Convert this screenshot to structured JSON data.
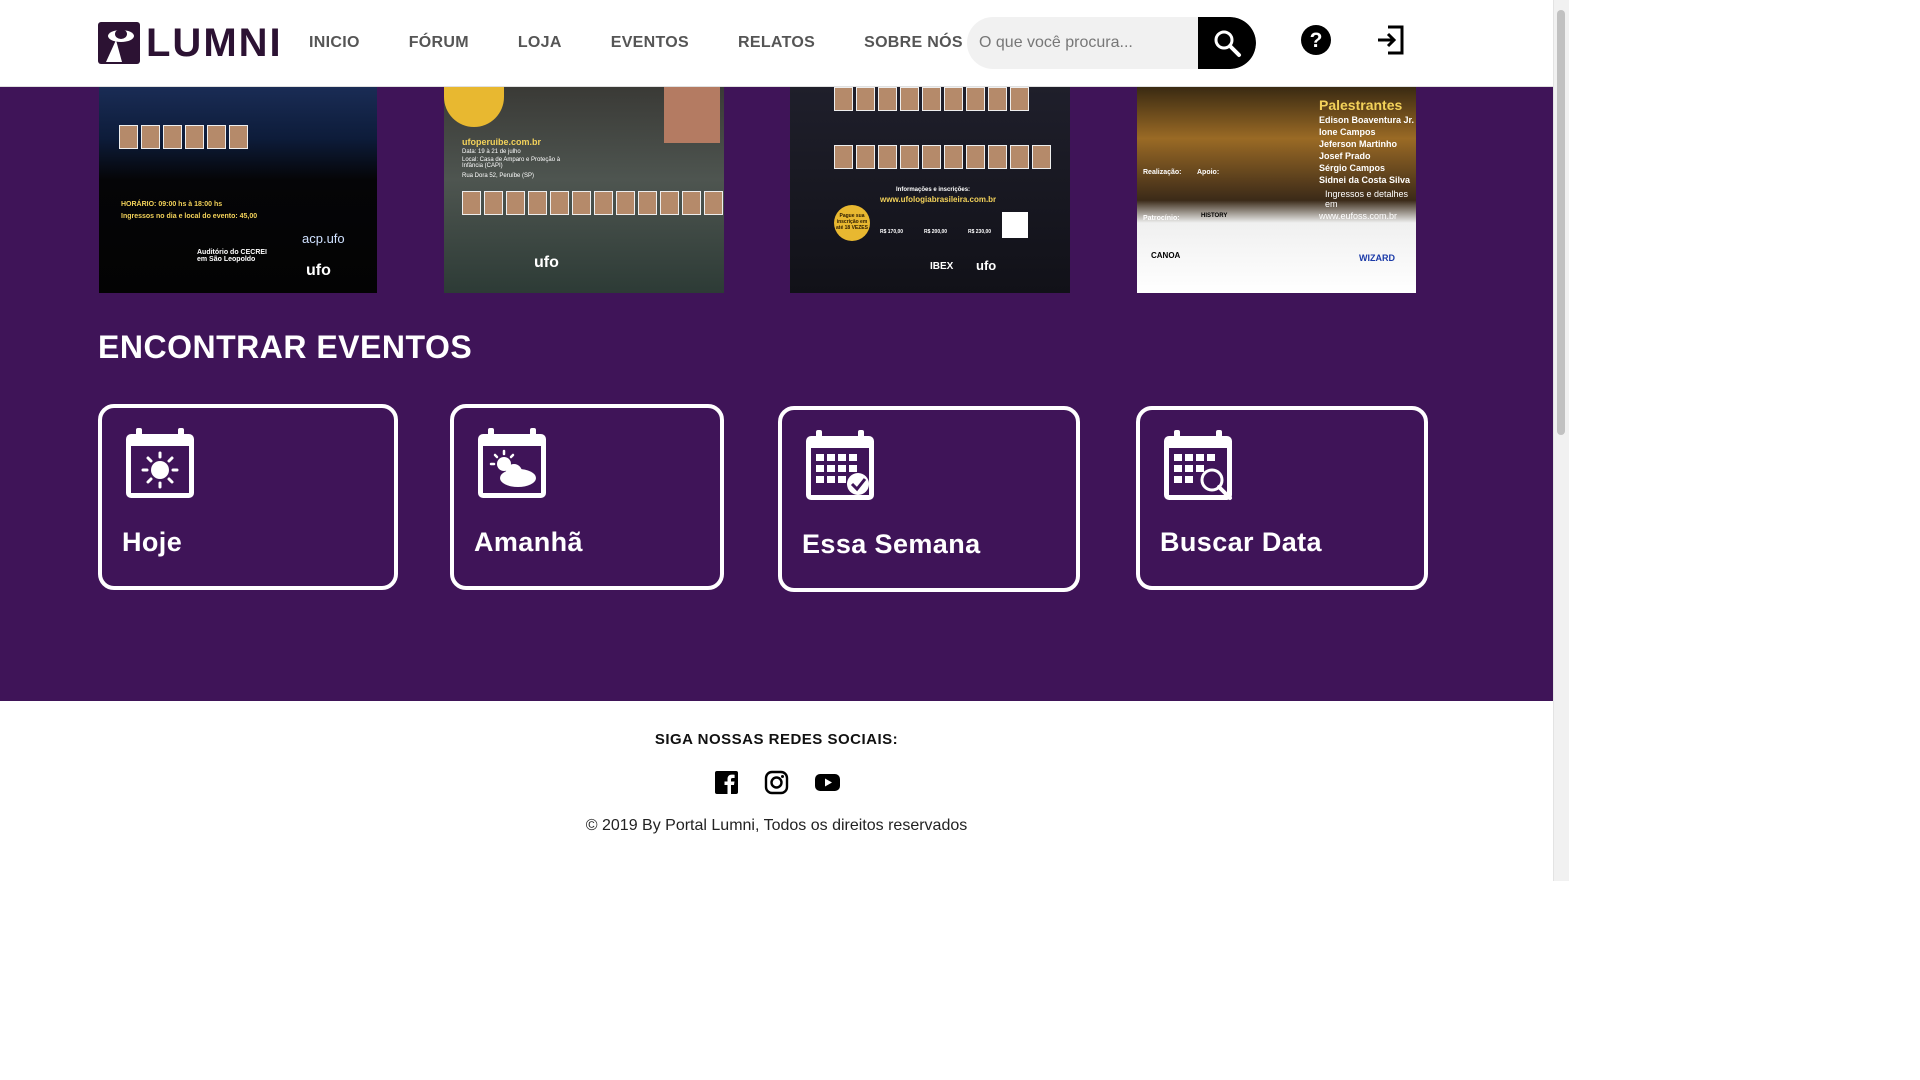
{
  "header": {
    "logo_text": "LUMNI",
    "nav": [
      "INICIO",
      "FÓRUM",
      "LOJA",
      "EVENTOS",
      "RELATOS",
      "SOBRE NÓS"
    ],
    "search_placeholder": "O que você procura..."
  },
  "posters": [
    {
      "lines": [
        "HORÁRIO: 09:00 hs à 18:00 hs",
        "Ingressos no dia e local do evento: 45,00",
        "Auditório do CECREI em São Leopoldo",
        "acp.ufo",
        "ufo"
      ]
    },
    {
      "lines": [
        "ufoperuibe.com.br",
        "Data: 19 à 21 de julho",
        "Local: Casa de Amparo e Proteção à Infância (CAPI)",
        "Rua Dora 52, Peruíbe (SP)",
        "ufo"
      ]
    },
    {
      "lines": [
        "Informações e inscrições:",
        "www.ufologiabrasileira.com.br",
        "Pague sua inscrição em até 18 VEZES",
        "R$ 170,00",
        "R$ 200,00",
        "R$ 230,00",
        "IBEX",
        "ufo"
      ]
    },
    {
      "lines": [
        "Palestrantes",
        "Edison Boaventura Jr.",
        "Ione Campos",
        "Jeferson Martinho",
        "Josef Prado",
        "Sérgio Campos",
        "Sidnei da Costa Silva",
        "Ingressos e detalhes em",
        "www.eufoss.com.br",
        "Realização:",
        "Apoio:",
        "Patrocínio:",
        "HISTORY",
        "WIZARD",
        "CANOA"
      ]
    }
  ],
  "events": {
    "title": "ENCONTRAR EVENTOS",
    "cards": [
      {
        "label": "Hoje",
        "icon": "calendar-sun-icon"
      },
      {
        "label": "Amanhã",
        "icon": "calendar-cloud-sun-icon"
      },
      {
        "label": "Essa Semana",
        "icon": "calendar-check-icon"
      },
      {
        "label": "Buscar Data",
        "icon": "calendar-search-icon"
      }
    ]
  },
  "footer": {
    "social_title": "SIGA NOSSAS REDES SOCIAIS:",
    "social": [
      "facebook-icon",
      "instagram-icon",
      "youtube-icon"
    ],
    "copyright": "© 2019 By Portal Lumni, Todos os direitos reservados"
  },
  "colors": {
    "brand_purple": "#3f1458",
    "logo_dark": "#2c1233",
    "accent_gold": "#f3d25a"
  }
}
